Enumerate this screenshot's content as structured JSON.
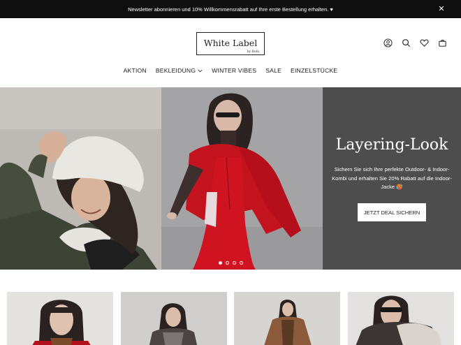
{
  "announcement": {
    "text": "Newsletter abonnieren und 10% Willkommensrabatt auf Ihre erste Bestellung erhalten. ♥",
    "close_icon": "close-icon"
  },
  "logo": {
    "main": "White Label",
    "by": "by Rofa"
  },
  "header_icons": [
    "account-icon",
    "search-icon",
    "wishlist-heart-icon",
    "cart-bag-icon"
  ],
  "nav": {
    "items": [
      {
        "label": "AKTION"
      },
      {
        "label": "BEKLEIDUNG",
        "has_dropdown": true
      },
      {
        "label": "WINTER VIBES"
      },
      {
        "label": "SALE"
      },
      {
        "label": "EINZELSTÜCKE"
      }
    ]
  },
  "hero": {
    "title": "Layering-Look",
    "text": "Sichern Sie sich Ihre perfekte Outdoor- & Indoor-Kombi und erhalten Sie 20% Rabatt auf die Indoor-Jacke 🥵",
    "button": "JETZT DEAL SICHERN",
    "slide_count": 4,
    "active_slide": 1
  },
  "colors": {
    "announcement_bg": "#0f0f0f",
    "hero_panel_bg": "#4d4d4d",
    "accent_red": "#c8101e"
  }
}
